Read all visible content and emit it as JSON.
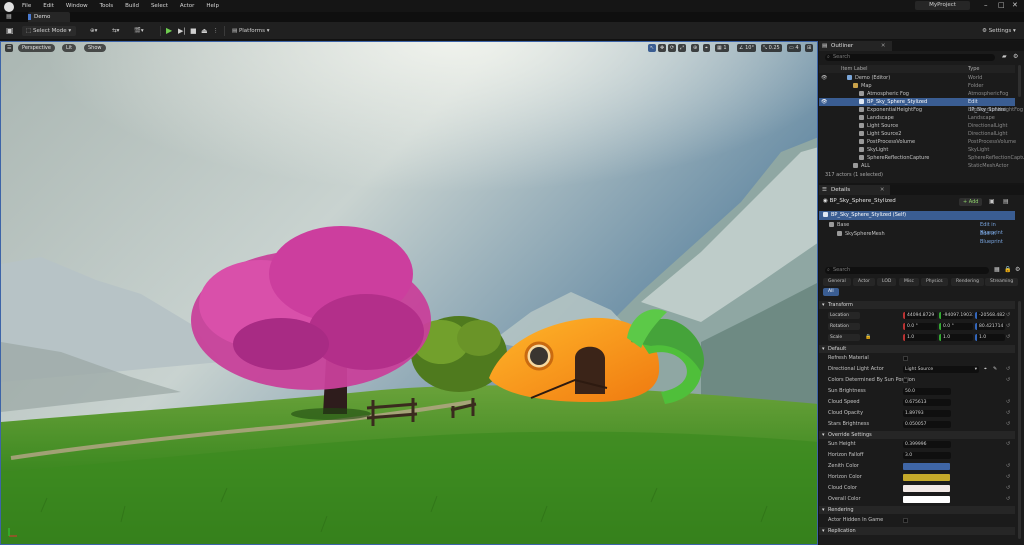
{
  "menu": {
    "items": [
      "File",
      "Edit",
      "Window",
      "Tools",
      "Build",
      "Select",
      "Actor",
      "Help"
    ],
    "project_name": "MyProject"
  },
  "tabs": {
    "level_tab": "Demo"
  },
  "toolbar": {
    "select_mode": "Select Mode",
    "platforms": "Platforms",
    "settings": "Settings"
  },
  "viewport": {
    "perspective": "Perspective",
    "lit": "Lit",
    "show": "Show",
    "grid_snap": "10",
    "rot_snap": "10°",
    "scale_snap": "0.25",
    "camera_speed": "4",
    "layer_count": "1"
  },
  "outliner": {
    "title": "Outliner",
    "search_placeholder": "Search",
    "col_label": "Item Label",
    "col_type": "Type",
    "rows": [
      {
        "label": "Demo (Editor)",
        "type": "World"
      },
      {
        "label": "Map",
        "type": "Folder"
      },
      {
        "label": "Atmospheric Fog",
        "type": "AtmosphericFog"
      },
      {
        "label": "BP_Sky_Sphere_Stylized",
        "type": "Edit BP_Sky_Sphere"
      },
      {
        "label": "ExponentialHeightFog",
        "type": "ExponentialHeightFog"
      },
      {
        "label": "Landscape",
        "type": "Landscape"
      },
      {
        "label": "Light Source",
        "type": "DirectionalLight"
      },
      {
        "label": "Light Source2",
        "type": "DirectionalLight"
      },
      {
        "label": "PostProcessVolume",
        "type": "PostProcessVolume"
      },
      {
        "label": "SkyLight",
        "type": "SkyLight"
      },
      {
        "label": "SphereReflectionCapture",
        "type": "SphereReflectionCaptu"
      },
      {
        "label": "ALL",
        "type": "StaticMeshActor"
      }
    ],
    "status": "317 actors (1 selected)"
  },
  "details": {
    "title": "Details",
    "actor_name": "BP_Sky_Sphere_Stylized",
    "add_label": "+ Add",
    "self_row": "BP_Sky_Sphere_Stylized (Self)",
    "components": [
      {
        "label": "Base",
        "action": "Edit in Blueprint"
      },
      {
        "label": "SkySphereMesh",
        "action": "Edit in Blueprint"
      }
    ],
    "search_placeholder": "Search",
    "filter_tabs": [
      "General",
      "Actor",
      "LOD",
      "Misc",
      "Physics",
      "Rendering",
      "Streaming",
      "All"
    ],
    "transform": {
      "header": "Transform",
      "location_label": "Location",
      "location": [
        "44094.8729",
        "-94097.19031",
        "-20568.48242"
      ],
      "rotation_label": "Rotation",
      "rotation": [
        "0.0 °",
        "0.0 °",
        "80.421714 °"
      ],
      "scale_label": "Scale",
      "scale": [
        "1.0",
        "1.0",
        "1.0"
      ]
    },
    "default": {
      "header": "Default",
      "refresh_material": "Refresh Material",
      "dir_light_actor": "Directional Light Actor",
      "dir_light_value": "Light Source",
      "colors_by_sun": "Colors Determined By Sun Position",
      "sun_brightness": "Sun Brightness",
      "sun_brightness_v": "50.0",
      "cloud_speed": "Cloud Speed",
      "cloud_speed_v": "0.675613",
      "cloud_opacity": "Cloud Opacity",
      "cloud_opacity_v": "1.89793",
      "stars_brightness": "Stars Brightness",
      "stars_brightness_v": "0.050057"
    },
    "override": {
      "header": "Override Settings",
      "sun_height": "Sun Height",
      "sun_height_v": "0.399996",
      "horizon_falloff": "Horizon Falloff",
      "horizon_falloff_v": "3.0",
      "zenith_color": "Zenith Color",
      "horizon_color": "Horizon Color",
      "cloud_color": "Cloud Color",
      "overall_color": "Overall Color"
    },
    "colors": {
      "zenith": "#3f66a6",
      "horizon": "#c4a92a",
      "cloud": "#f2e9e6",
      "overall": "#ffffff"
    },
    "rendering": {
      "header": "Rendering",
      "hidden_in_game": "Actor Hidden In Game"
    },
    "replication_header": "Replication"
  },
  "theme": {
    "accent": "#3a5d92",
    "selection_border": "#3d64a8"
  }
}
